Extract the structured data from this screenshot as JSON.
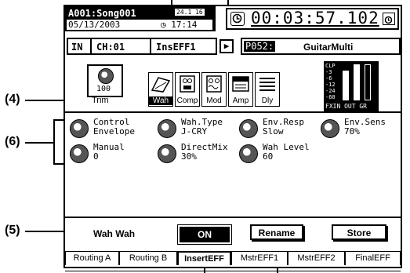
{
  "callouts": {
    "c4": "(4)",
    "c6": "(6)",
    "c5": "(5)"
  },
  "header": {
    "song": "A001:Song001",
    "date": "05/13/2003",
    "format": "24.1 16",
    "time_of_day": "◷ 17:14",
    "counter": "00:03:57.102",
    "clock_icon": "clock-icon",
    "lock_icon": "locked-icon"
  },
  "channel_bar": {
    "io": "IN",
    "channel": "CH:01",
    "insert": "InsEFF1",
    "arrow": "▶",
    "preset_num": "P052:",
    "preset_name": "GuitarMulti"
  },
  "trim": {
    "value": "100",
    "label": "Trim"
  },
  "effects": [
    {
      "label": "Wah",
      "icon": "wah-pedal-icon",
      "selected": true
    },
    {
      "label": "Comp",
      "icon": "compressor-icon",
      "selected": false
    },
    {
      "label": "Mod",
      "icon": "modulation-icon",
      "selected": false
    },
    {
      "label": "Amp",
      "icon": "amp-icon",
      "selected": false
    },
    {
      "label": "Dly",
      "icon": "delay-icon",
      "selected": false
    }
  ],
  "meter": {
    "scale": [
      "CLP",
      "-3",
      "-6",
      "-12",
      "-24",
      "-60"
    ],
    "labels": "FXIN OUT GR"
  },
  "params": [
    {
      "label": "Control",
      "value": "Envelope"
    },
    {
      "label": "Wah.Type",
      "value": "J-CRY"
    },
    {
      "label": "Env.Resp",
      "value": "Slow"
    },
    {
      "label": "Env.Sens",
      "value": "70%"
    },
    {
      "label": "Manual",
      "value": "0"
    },
    {
      "label": "DirectMix",
      "value": "30%"
    },
    {
      "label": "Wah Level",
      "value": "60"
    }
  ],
  "wah_section": {
    "name": "Wah Wah",
    "state": "ON"
  },
  "buttons": {
    "rename": "Rename",
    "store": "Store"
  },
  "tabs": [
    "Routing A",
    "Routing B",
    "InsertEFF",
    "MstrEFF1",
    "MstrEFF2",
    "FinalEFF"
  ],
  "active_tab": "InsertEFF"
}
